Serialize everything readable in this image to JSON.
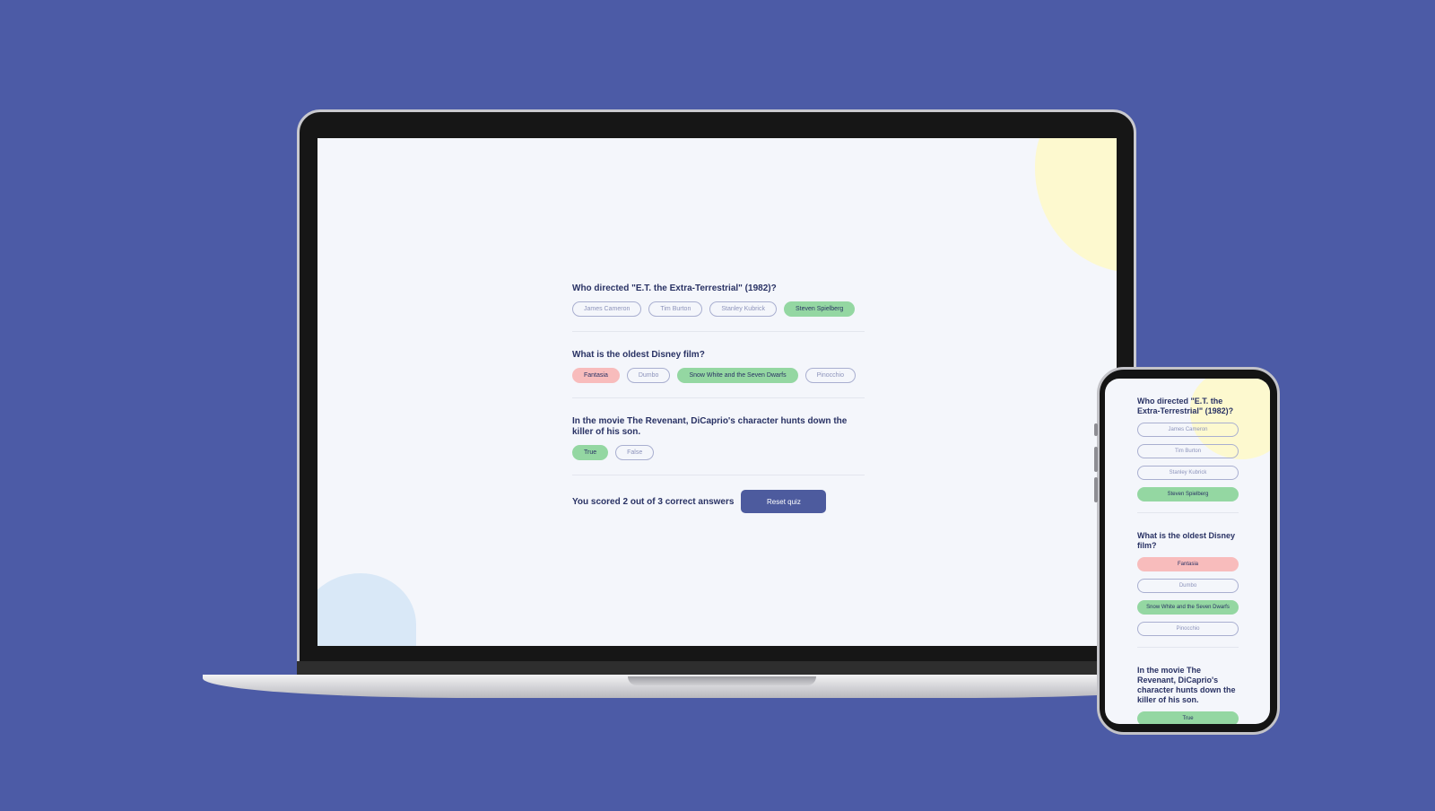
{
  "colors": {
    "background": "#4c5ba6",
    "correct": "#94d7a2",
    "wrong": "#f8bcbc",
    "accent": "#4d5b9e",
    "text": "#293264"
  },
  "laptop": {
    "questions": [
      {
        "text": "Who directed \"E.T. the Extra-Terrestrial\" (1982)?",
        "answers": [
          {
            "label": "James Cameron",
            "state": "default"
          },
          {
            "label": "Tim Burton",
            "state": "default"
          },
          {
            "label": "Stanley Kubrick",
            "state": "default"
          },
          {
            "label": "Steven Spielberg",
            "state": "correct"
          }
        ]
      },
      {
        "text": "What is the oldest Disney film?",
        "answers": [
          {
            "label": "Fantasia",
            "state": "wrong"
          },
          {
            "label": "Dumbo",
            "state": "default"
          },
          {
            "label": "Snow White and the Seven Dwarfs",
            "state": "correct"
          },
          {
            "label": "Pinocchio",
            "state": "default"
          }
        ]
      },
      {
        "text": "In the movie The Revenant, DiCaprio's character hunts down the killer of his son.",
        "answers": [
          {
            "label": "True",
            "state": "correct"
          },
          {
            "label": "False",
            "state": "default"
          }
        ]
      }
    ],
    "score_text": "You scored 2 out of 3 correct answers",
    "reset_label": "Reset quiz"
  },
  "phone": {
    "questions": [
      {
        "text": "Who directed \"E.T. the Extra-Terrestrial\" (1982)?",
        "answers": [
          {
            "label": "James Cameron",
            "state": "default"
          },
          {
            "label": "Tim Burton",
            "state": "default"
          },
          {
            "label": "Stanley Kubrick",
            "state": "default"
          },
          {
            "label": "Steven Spielberg",
            "state": "correct"
          }
        ]
      },
      {
        "text": "What is the oldest Disney film?",
        "answers": [
          {
            "label": "Fantasia",
            "state": "wrong"
          },
          {
            "label": "Dumbo",
            "state": "default"
          },
          {
            "label": "Snow White and the Seven Dwarfs",
            "state": "correct"
          },
          {
            "label": "Pinocchio",
            "state": "default"
          }
        ]
      },
      {
        "text": "In the movie The Revenant, DiCaprio's character hunts down the killer of his son.",
        "answers": [
          {
            "label": "True",
            "state": "correct"
          }
        ]
      }
    ]
  }
}
